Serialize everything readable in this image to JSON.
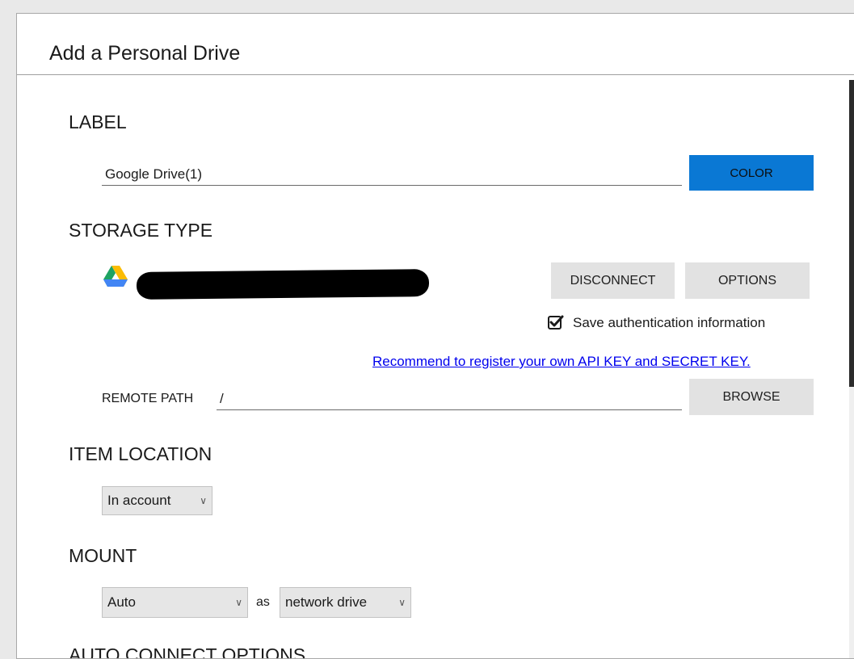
{
  "dialog": {
    "title": "Add a Personal Drive"
  },
  "sections": {
    "label": "LABEL",
    "storage_type": "STORAGE TYPE",
    "item_location": "ITEM LOCATION",
    "mount": "MOUNT",
    "auto_connect": "AUTO CONNECT OPTIONS"
  },
  "label_field": {
    "value": "Google Drive(1)",
    "color_button": "COLOR"
  },
  "storage": {
    "icon": "google-drive-icon",
    "disconnect_button": "DISCONNECT",
    "options_button": "OPTIONS",
    "save_auth_label": "Save authentication information",
    "save_auth_checked": true,
    "register_link": "Recommend to register your own API KEY and SECRET KEY."
  },
  "remote_path": {
    "label": "REMOTE PATH",
    "value": "/",
    "browse_button": "BROWSE"
  },
  "item_location": {
    "selected": "In account"
  },
  "mount": {
    "selected": "Auto",
    "as_label": "as",
    "type_selected": "network drive"
  },
  "colors": {
    "accent": "#0a78d4",
    "link": "#0000ee",
    "button_bg": "#e2e2e2"
  }
}
